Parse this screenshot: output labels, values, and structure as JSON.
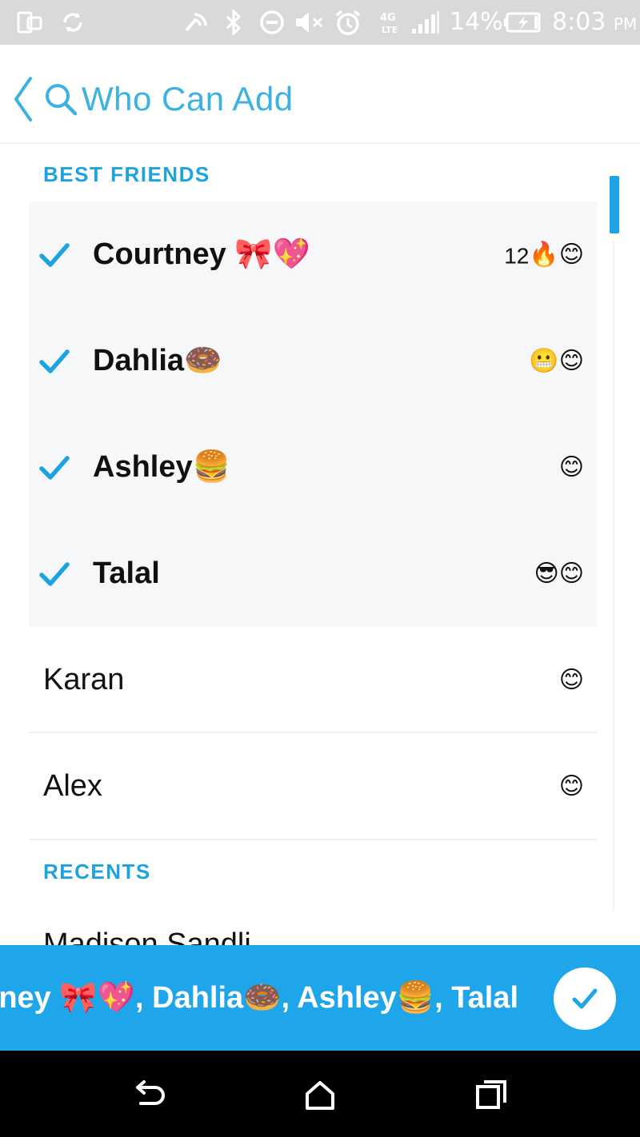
{
  "status_bar": {
    "battery": "14%",
    "time": "8:03",
    "ampm": "PM",
    "icons": [
      "screen-mirror-icon",
      "sync-icon",
      "nfc-icon",
      "bluetooth-icon",
      "do-not-disturb-icon",
      "mute-icon",
      "alarm-icon",
      "lte-icon",
      "signal-icon",
      "battery-icon"
    ]
  },
  "header": {
    "title": "Who Can Add",
    "accent_color": "#3cb2e2"
  },
  "sections": {
    "best_friends": "BEST FRIENDS",
    "recents": "RECENTS"
  },
  "best_friends": [
    {
      "name": "Courtney 🎀💖",
      "streak": "12",
      "emojis": "🔥😊",
      "selected": true
    },
    {
      "name": "Dahlia🍩",
      "streak": "",
      "emojis": "😬😊",
      "selected": true
    },
    {
      "name": "Ashley🍔",
      "streak": "",
      "emojis": "😊",
      "selected": true
    },
    {
      "name": "Talal",
      "streak": "",
      "emojis": "😎😊",
      "selected": true
    },
    {
      "name": "Karan",
      "streak": "",
      "emojis": "😊",
      "selected": false
    },
    {
      "name": "Alex",
      "streak": "",
      "emojis": "😊",
      "selected": false
    }
  ],
  "recents": [
    {
      "name": "Madison Sandli"
    }
  ],
  "selection_bar": {
    "text": "Courtney 🎀💖, Dahlia🍩, Ashley🍔, Talal",
    "color": "#1fa5ea"
  },
  "nav_bar": {
    "icons": [
      "back-icon",
      "home-icon",
      "recents-icon"
    ]
  }
}
